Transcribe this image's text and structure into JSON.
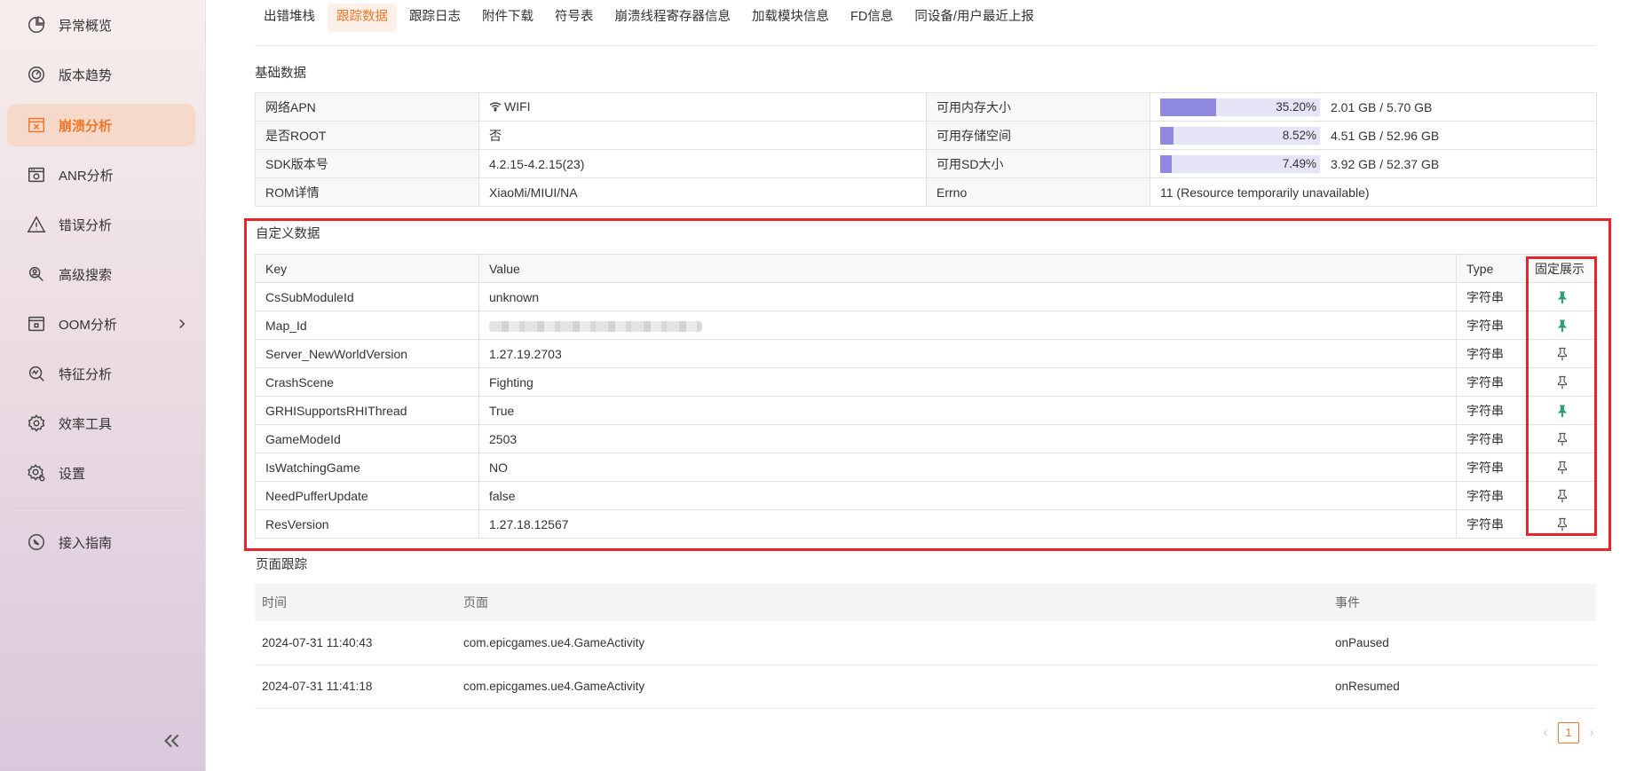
{
  "sidebar": {
    "items": [
      {
        "label": "异常概览",
        "icon": "pie-chart-icon"
      },
      {
        "label": "版本趋势",
        "icon": "gauge-icon"
      },
      {
        "label": "崩溃分析",
        "icon": "crash-window-icon"
      },
      {
        "label": "ANR分析",
        "icon": "app-window-icon"
      },
      {
        "label": "错误分析",
        "icon": "warning-icon"
      },
      {
        "label": "高级搜索",
        "icon": "search-person-icon"
      },
      {
        "label": "OOM分析",
        "icon": "memory-icon"
      },
      {
        "label": "特征分析",
        "icon": "feature-search-icon"
      },
      {
        "label": "效率工具",
        "icon": "gear-icon"
      },
      {
        "label": "设置",
        "icon": "settings-icon"
      },
      {
        "label": "接入指南",
        "icon": "compass-icon"
      }
    ],
    "active": "崩溃分析"
  },
  "tabs": [
    "出错堆栈",
    "跟踪数据",
    "跟踪日志",
    "附件下载",
    "符号表",
    "崩溃线程寄存器信息",
    "加载模块信息",
    "FD信息",
    "同设备/用户最近上报"
  ],
  "active_tab": "跟踪数据",
  "basic": {
    "title": "基础数据",
    "rows": [
      {
        "k1": "网络APN",
        "v1": "WIFI",
        "k2": "可用内存大小",
        "pct": "35.20%",
        "frac": 0.352,
        "detail": "2.01 GB / 5.70 GB"
      },
      {
        "k1": "是否ROOT",
        "v1": "否",
        "k2": "可用存储空间",
        "pct": "8.52%",
        "frac": 0.0852,
        "detail": "4.51 GB / 52.96 GB"
      },
      {
        "k1": "SDK版本号",
        "v1": "4.2.15-4.2.15(23)",
        "k2": "可用SD大小",
        "pct": "7.49%",
        "frac": 0.0749,
        "detail": "3.92 GB / 52.37 GB"
      },
      {
        "k1": "ROM详情",
        "v1": "XiaoMi/MIUI/NA",
        "k2": "Errno",
        "v2": "11 (Resource temporarily unavailable)"
      }
    ]
  },
  "custom": {
    "title": "自定义数据",
    "headers": {
      "key": "Key",
      "value": "Value",
      "type": "Type",
      "pin": "固定展示"
    },
    "rows": [
      {
        "key": "CsSubModuleId",
        "value": "unknown",
        "type": "字符串",
        "pinned": true
      },
      {
        "key": "Map_Id",
        "value": "",
        "type": "字符串",
        "pinned": true
      },
      {
        "key": "Server_NewWorldVersion",
        "value": "1.27.19.2703",
        "type": "字符串",
        "pinned": false
      },
      {
        "key": "CrashScene",
        "value": "Fighting",
        "type": "字符串",
        "pinned": false
      },
      {
        "key": "GRHISupportsRHIThread",
        "value": "True",
        "type": "字符串",
        "pinned": true
      },
      {
        "key": "GameModeId",
        "value": "2503",
        "type": "字符串",
        "pinned": false
      },
      {
        "key": "IsWatchingGame",
        "value": "NO",
        "type": "字符串",
        "pinned": false
      },
      {
        "key": "NeedPufferUpdate",
        "value": "false",
        "type": "字符串",
        "pinned": false
      },
      {
        "key": "ResVersion",
        "value": "1.27.18.12567",
        "type": "字符串",
        "pinned": false
      }
    ]
  },
  "page_trace": {
    "title": "页面跟踪",
    "headers": {
      "time": "时间",
      "page": "页面",
      "event": "事件"
    },
    "rows": [
      {
        "time": "2024-07-31 11:40:43",
        "page": "com.epicgames.ue4.GameActivity",
        "event": "onPaused"
      },
      {
        "time": "2024-07-31 11:41:18",
        "page": "com.epicgames.ue4.GameActivity",
        "event": "onResumed"
      }
    ]
  },
  "pagination": {
    "current": "1",
    "prev": "‹",
    "next": "›"
  },
  "colors": {
    "accent": "#f0772a",
    "bar": "#8f89e2",
    "bar_bg": "#e6e4f7",
    "pin_active": "#2e9e7e",
    "highlight": "#e8242c"
  }
}
